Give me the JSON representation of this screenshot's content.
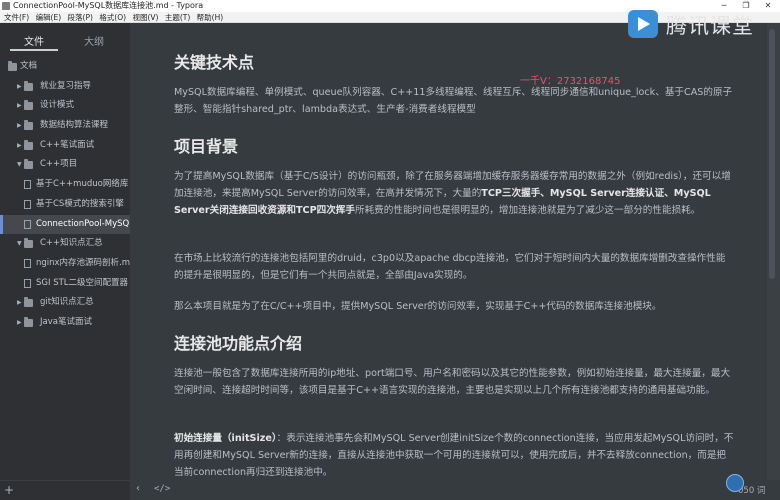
{
  "window": {
    "title": "ConnectionPool-MySQL数据库连接池.md - Typora",
    "minimize": "─",
    "restore": "❐",
    "close": "✕"
  },
  "menu": [
    "文件(F)",
    "编辑(E)",
    "段落(P)",
    "格式(O)",
    "视图(V)",
    "主题(T)",
    "帮助(H)"
  ],
  "sidebar": {
    "tabs": {
      "files": "文件",
      "outline": "大纲"
    },
    "items": [
      {
        "label": "文档",
        "type": "folder",
        "open": true,
        "depth": 0
      },
      {
        "label": "就业复习指导",
        "type": "folder",
        "open": false,
        "depth": 1
      },
      {
        "label": "设计模式",
        "type": "folder",
        "open": false,
        "depth": 1
      },
      {
        "label": "数据结构算法课程",
        "type": "folder",
        "open": false,
        "depth": 1
      },
      {
        "label": "C++笔试面试",
        "type": "folder",
        "open": false,
        "depth": 1
      },
      {
        "label": "C++项目",
        "type": "folder",
        "open": true,
        "depth": 1
      },
      {
        "label": "基于C++muduo网络库",
        "type": "file",
        "depth": 2
      },
      {
        "label": "基于CS模式的搜索引擎",
        "type": "file",
        "depth": 2
      },
      {
        "label": "ConnectionPool-MySQL",
        "type": "file",
        "depth": 2,
        "selected": true
      },
      {
        "label": "C++知识点汇总",
        "type": "folder",
        "open": true,
        "depth": 1
      },
      {
        "label": "nginx内存池源码剖析.m",
        "type": "file",
        "depth": 2
      },
      {
        "label": "SGI STL二级空间配置器",
        "type": "file",
        "depth": 2
      },
      {
        "label": "git知识点汇总",
        "type": "folder",
        "open": false,
        "depth": 1
      },
      {
        "label": "Java笔试面试",
        "type": "folder",
        "open": false,
        "depth": 1
      }
    ],
    "add_label": "+"
  },
  "watermark": {
    "text": "腾讯课堂"
  },
  "qq_note": "一千V：2732168745",
  "doc": {
    "h_tech": "关键技术点",
    "p_tech": "MySQL数据库编程、单例模式、queue队列容器、C++11多线程编程、线程互斥、线程同步通信和unique_lock、基于CAS的原子整形、智能指针shared_ptr、lambda表达式、生产者-消费者线程模型",
    "h_bg": "项目背景",
    "p_bg1_a": "为了提高MySQL数据库（基于C/S设计）的访问瓶颈，除了在服务器端增加缓存服务器缓存常用的数据之外（例如redis），还可以增加连接池，来提高MySQL Server的访问效率，在高并发情况下，大量的",
    "p_bg1_b1": "TCP三次握手、MySQL Server连接认证、MySQL Server关闭连接回收资源和TCP四次挥手",
    "p_bg1_c": "所耗费的性能时间也是很明显的，增加连接池就是为了减少这一部分的性能损耗。",
    "p_bg2": "在市场上比较流行的连接池包括阿里的druid，c3p0以及apache dbcp连接池，它们对于短时间内大量的数据库增删改查操作性能的提升是很明显的，但是它们有一个共同点就是，全部由Java实现的。",
    "p_bg3": "那么本项目就是为了在C/C++项目中，提供MySQL Server的访问效率，实现基于C++代码的数据库连接池模块。",
    "h_func": "连接池功能点介绍",
    "p_func1": "连接池一般包含了数据库连接所用的ip地址、port端口号、用户名和密码以及其它的性能参数，例如初始连接量，最大连接量，最大空闲时间、连接超时时间等，该项目是基于C++语言实现的连接池，主要也是实现以上几个所有连接池都支持的通用基础功能。",
    "p_func2_b": "初始连接量（initSize）",
    "p_func2_c": "：表示连接池事先会和MySQL Server创建initSize个数的connection连接，当应用发起MySQL访问时，不用再创建和MySQL Server新的连接，直接从连接池中获取一个可用的连接就可以，使用完成后，并不去释放connection，而是把当前connection再归还到连接池中。"
  },
  "status": {
    "back": "‹",
    "code": "</>",
    "count": "050 词"
  }
}
